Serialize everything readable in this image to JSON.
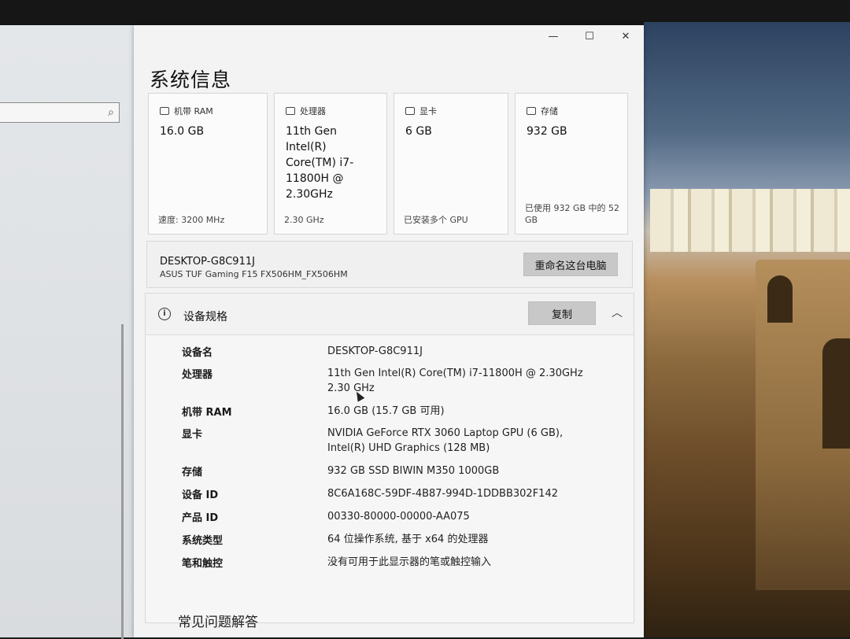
{
  "window": {
    "title": "系统信息",
    "controls": {
      "minimize": "—",
      "maximize": "☐",
      "close": "✕"
    }
  },
  "cards": [
    {
      "icon": "memory-icon",
      "label": "机带 RAM",
      "value": "16.0 GB",
      "footer": "速度: 3200 MHz"
    },
    {
      "icon": "processor-icon",
      "label": "处理器",
      "value": "11th Gen Intel(R) Core(TM) i7-11800H @ 2.30GHz",
      "footer": "2.30 GHz"
    },
    {
      "icon": "display-icon",
      "label": "显卡",
      "value": "6 GB",
      "footer": "已安装多个 GPU"
    },
    {
      "icon": "storage-icon",
      "label": "存储",
      "value": "932 GB",
      "footer": "已使用 932 GB 中的 52 GB"
    }
  ],
  "device": {
    "name": "DESKTOP-G8C911J",
    "model": "ASUS TUF Gaming F15 FX506HM_FX506HM",
    "rename_label": "重命名这台电脑"
  },
  "specs": {
    "title": "设备规格",
    "copy_label": "复制",
    "rows": [
      {
        "key": "设备名",
        "value": "DESKTOP-G8C911J"
      },
      {
        "key": "处理器",
        "value": "11th Gen Intel(R) Core(TM) i7-11800H @ 2.30GHz   2.30 GHz"
      },
      {
        "key": "机带 RAM",
        "value": "16.0 GB (15.7 GB 可用)"
      },
      {
        "key": "显卡",
        "value": "NVIDIA GeForce RTX 3060 Laptop GPU (6 GB), Intel(R) UHD Graphics (128 MB)"
      },
      {
        "key": "存储",
        "value": "932 GB SSD BIWIN M350 1000GB"
      },
      {
        "key": "设备 ID",
        "value": "8C6A168C-59DF-4B87-994D-1DDBB302F142"
      },
      {
        "key": "产品 ID",
        "value": "00330-80000-00000-AA075"
      },
      {
        "key": "系统类型",
        "value": "64 位操作系统, 基于 x64 的处理器"
      },
      {
        "key": "笔和触控",
        "value": "没有可用于此显示器的笔或触控输入"
      }
    ]
  },
  "faq_title": "常见问题解答"
}
